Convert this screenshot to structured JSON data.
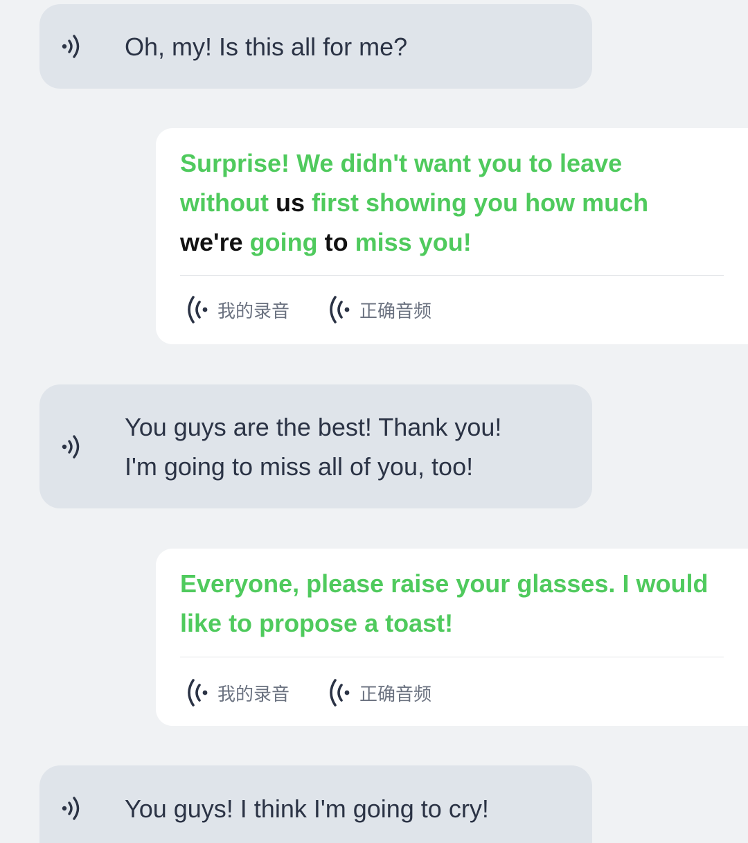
{
  "colors": {
    "page_background": "#f0f2f4",
    "incoming_bubble": "#dfe4ea",
    "outgoing_bubble": "#ffffff",
    "incoming_text": "#2b3345",
    "correct_word": "#4fca5d",
    "incorrect_word": "#111111",
    "action_label": "#6b7280"
  },
  "messages": [
    {
      "side": "left",
      "icon": "speaker-play-icon",
      "lines": [
        "Oh, my! Is this all for me?"
      ]
    },
    {
      "side": "right",
      "words": [
        {
          "t": "Surprise!",
          "ok": true
        },
        {
          "t": "We",
          "ok": true
        },
        {
          "t": "didn't",
          "ok": true
        },
        {
          "t": "want",
          "ok": true
        },
        {
          "t": "you",
          "ok": true
        },
        {
          "t": "to",
          "ok": true
        },
        {
          "t": "leave",
          "ok": true
        },
        {
          "t": "without",
          "ok": true
        },
        {
          "t": "us",
          "ok": false
        },
        {
          "t": "first",
          "ok": true
        },
        {
          "t": "showing",
          "ok": true
        },
        {
          "t": "you",
          "ok": true
        },
        {
          "t": "how",
          "ok": true
        },
        {
          "t": "much",
          "ok": true
        },
        {
          "t": "we're",
          "ok": false
        },
        {
          "t": "going",
          "ok": true
        },
        {
          "t": "to",
          "ok": false
        },
        {
          "t": "miss",
          "ok": true
        },
        {
          "t": "you!",
          "ok": true
        }
      ],
      "actions": [
        {
          "icon": "my-recording-icon",
          "label": "我的录音"
        },
        {
          "icon": "correct-audio-icon",
          "label": "正确音频"
        }
      ]
    },
    {
      "side": "left",
      "icon": "speaker-play-icon",
      "lines": [
        "You guys are the best! Thank you!",
        "I'm going to miss all of you, too!"
      ]
    },
    {
      "side": "right",
      "words": [
        {
          "t": "Everyone,",
          "ok": true
        },
        {
          "t": "please",
          "ok": true
        },
        {
          "t": "raise",
          "ok": true
        },
        {
          "t": "your",
          "ok": true
        },
        {
          "t": "glasses.",
          "ok": true
        },
        {
          "t": "I",
          "ok": true
        },
        {
          "t": "would",
          "ok": true
        },
        {
          "t": "like",
          "ok": true
        },
        {
          "t": "to",
          "ok": true
        },
        {
          "t": "propose",
          "ok": true
        },
        {
          "t": "a",
          "ok": true
        },
        {
          "t": "toast!",
          "ok": true
        }
      ],
      "actions": [
        {
          "icon": "my-recording-icon",
          "label": "我的录音"
        },
        {
          "icon": "correct-audio-icon",
          "label": "正确音频"
        }
      ]
    },
    {
      "side": "left",
      "icon": "speaker-play-icon",
      "lines": [
        "You guys! I think I'm going to cry!"
      ]
    }
  ]
}
